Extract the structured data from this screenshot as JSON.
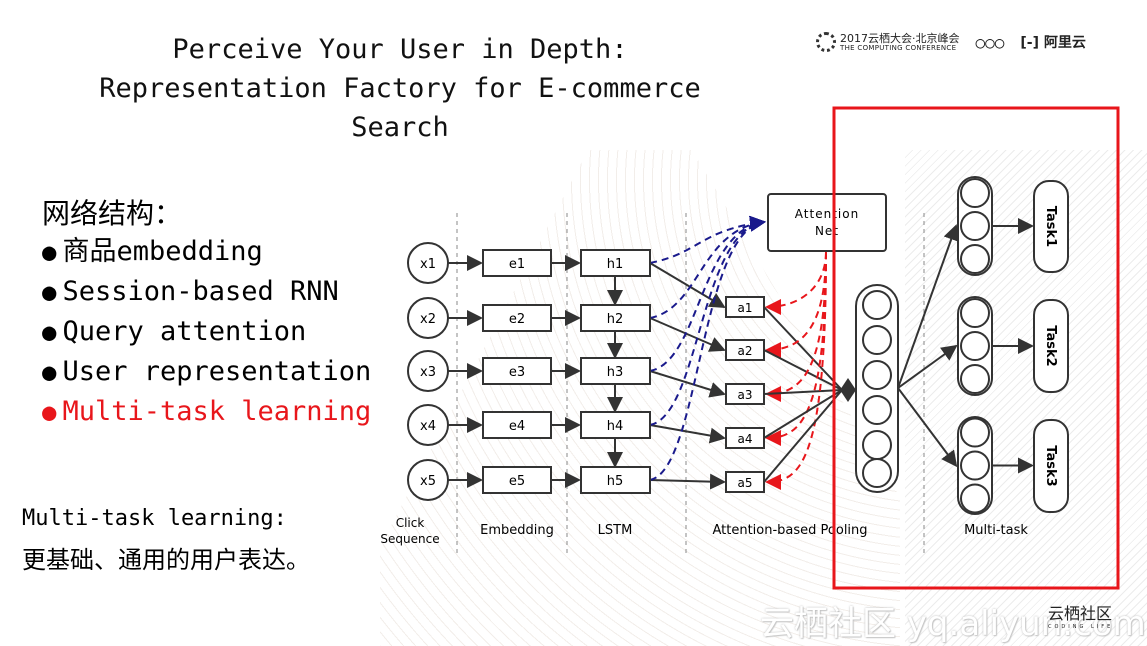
{
  "title": "Perceive Your User in Depth: Representation Factory for E-commerce Search",
  "title_lines": [
    "Perceive Your User in Depth:",
    "Representation Factory for E-commerce",
    "Search"
  ],
  "logos": {
    "conference_cn": "2017云栖大会·北京峰会",
    "conference_en": "THE COMPUTING CONFERENCE",
    "olympic": "○○○",
    "aliyun": "阿里云"
  },
  "heading": "网络结构：",
  "bullets": [
    {
      "text": "商品embedding",
      "highlight": false
    },
    {
      "text": "Session-based RNN",
      "highlight": false
    },
    {
      "text": "Query attention",
      "highlight": false
    },
    {
      "text": "User representation",
      "highlight": false
    },
    {
      "text": "Multi-task learning",
      "highlight": true
    }
  ],
  "highlight_color": "#e8161b",
  "multitask_title": "Multi-task learning:",
  "multitask_desc": "更基础、通用的用户表达。",
  "diagram": {
    "inputs": [
      "x1",
      "x2",
      "x3",
      "x4",
      "x5"
    ],
    "embeddings": [
      "e1",
      "e2",
      "e3",
      "e4",
      "e5"
    ],
    "hidden": [
      "h1",
      "h2",
      "h3",
      "h4",
      "h5"
    ],
    "attention": [
      "a1",
      "a2",
      "a3",
      "a4",
      "a5"
    ],
    "attention_net": [
      "Attention",
      "Net"
    ],
    "tasks": [
      "Task1",
      "Task2",
      "Task3"
    ],
    "section_labels": {
      "click": [
        "Click",
        "Sequence"
      ],
      "embedding": "Embedding",
      "lstm": "LSTM",
      "pooling": "Attention-based Pooling",
      "multitask": "Multi-task"
    },
    "colors": {
      "query_arrows": "#1a1a8c",
      "attention_arrows": "#e8161b",
      "highlight_box": "#e8161b"
    }
  },
  "watermark": {
    "text": "云栖社区 yq.aliyun.com",
    "brand": "云栖社区",
    "brand_sub": "CODING LIFE"
  }
}
